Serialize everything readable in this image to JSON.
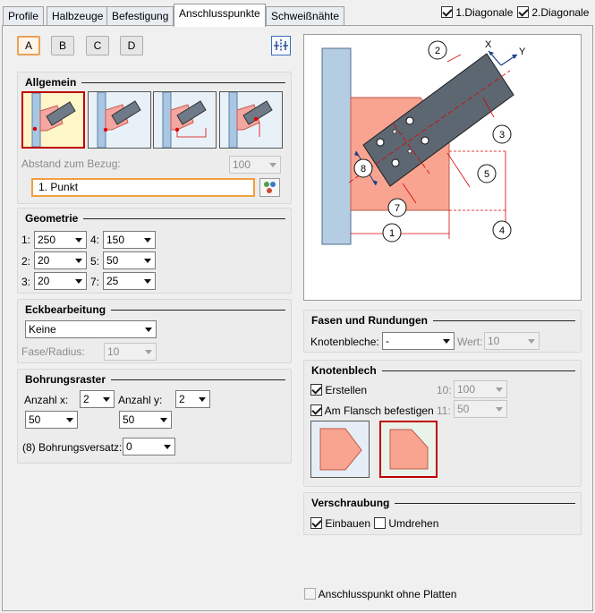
{
  "tabs": [
    "Profile",
    "Halbzeuge",
    "Befestigung",
    "Anschlusspunkte",
    "Schweißnähte"
  ],
  "active_tab": 3,
  "header_checks": {
    "diag1": "1.Diagonale",
    "diag2": "2.Diagonale"
  },
  "variants": [
    "A",
    "B",
    "C",
    "D"
  ],
  "allgemein": {
    "title": "Allgemein",
    "abstand_label": "Abstand zum Bezug:",
    "abstand_value": "100",
    "punkt_value": "1. Punkt"
  },
  "geometrie": {
    "title": "Geometrie",
    "fields": [
      {
        "label": "1:",
        "value": "250"
      },
      {
        "label": "4:",
        "value": "150"
      },
      {
        "label": "2:",
        "value": "20"
      },
      {
        "label": "5:",
        "value": "50"
      },
      {
        "label": "3:",
        "value": "20"
      },
      {
        "label": "7:",
        "value": "25"
      }
    ]
  },
  "eck": {
    "title": "Eckbearbeitung",
    "mode": "Keine",
    "fase_label": "Fase/Radius:",
    "fase_value": "10"
  },
  "bohrung": {
    "title": "Bohrungsraster",
    "anzahl_x_label": "Anzahl x:",
    "anzahl_x": "2",
    "anzahl_y_label": "Anzahl y:",
    "anzahl_y": "2",
    "dist_x": "50",
    "dist_y": "50",
    "versatz_label": "(8) Bohrungsversatz:",
    "versatz": "0"
  },
  "diagram": {
    "labels": [
      "1",
      "2",
      "3",
      "4",
      "5",
      "7",
      "8"
    ],
    "axis_x": "X",
    "axis_y": "Y"
  },
  "fasen": {
    "title": "Fasen und Rundungen",
    "knoten_label": "Knotenbleche:",
    "knoten_value": "-",
    "wert_label": "Wert:",
    "wert_value": "10"
  },
  "knotenblech": {
    "title": "Knotenblech",
    "erstellen": "Erstellen",
    "flansch": "Am Flansch befestigen",
    "f10_label": "10:",
    "f10_value": "100",
    "f11_label": "11:",
    "f11_value": "50"
  },
  "verschraubung": {
    "title": "Verschraubung",
    "einbauen": "Einbauen",
    "umdrehen": "Umdrehen"
  },
  "footer": {
    "ohne_platten": "Anschlusspunkt ohne Platten"
  }
}
